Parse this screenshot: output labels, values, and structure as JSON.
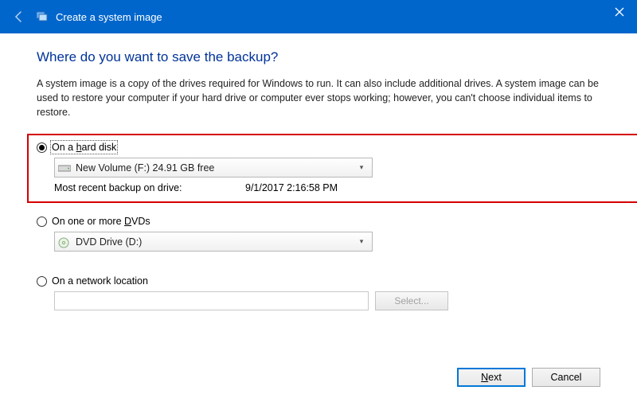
{
  "titlebar": {
    "title": "Create a system image"
  },
  "heading": "Where do you want to save the backup?",
  "description": "A system image is a copy of the drives required for Windows to run. It can also include additional drives. A system image can be used to restore your computer if your hard drive or computer ever stops working; however, you can't choose individual items to restore.",
  "options": {
    "hard_disk": {
      "label_pre": "On a ",
      "label_key": "h",
      "label_post": "ard disk",
      "drive": "New Volume (F:)  24.91 GB free",
      "meta_label": "Most recent backup on drive:",
      "meta_value": "9/1/2017 2:16:58 PM"
    },
    "dvds": {
      "label_pre": "On one or more ",
      "label_key": "D",
      "label_post": "VDs",
      "drive": "DVD Drive (D:)"
    },
    "network": {
      "label": "On a network location",
      "value": "",
      "select_btn": "Select..."
    }
  },
  "footer": {
    "next_key": "N",
    "next_post": "ext",
    "cancel": "Cancel"
  }
}
